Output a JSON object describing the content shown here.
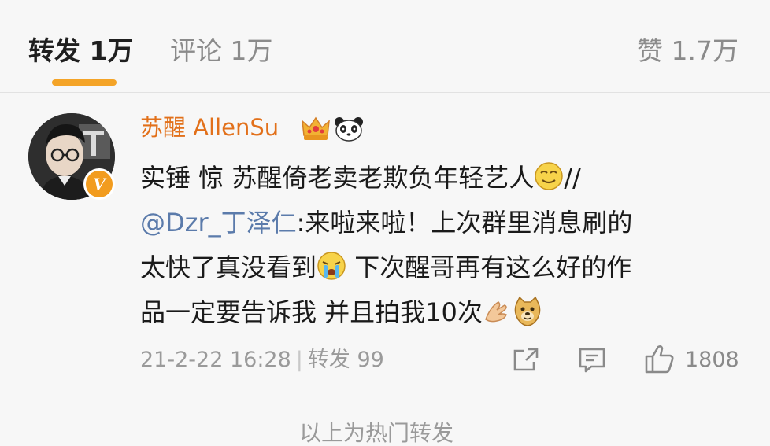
{
  "tabs": {
    "repost": "转发 1万",
    "comment": "评论 1万",
    "like": "赞 1.7万"
  },
  "post": {
    "username": "苏醒 AllenSu",
    "content_lines": [
      "实锤 惊 苏醒倚老卖老欺负年轻艺人",
      "//",
      "@Dzr_丁泽仁",
      ":来啦来啦！上次群里消息刷的",
      "太快了真没看到",
      " 下次醒哥再有这么好的作",
      "品一定要告诉我 并且拍我10次"
    ],
    "timestamp": "21-2-22 16:28",
    "separator": "|",
    "repost_info": "转发 99",
    "like_count": "1808"
  },
  "footer": {
    "text": "以上为热门转发"
  },
  "colors": {
    "accent": "#f4a428",
    "username": "#e2701a",
    "mention": "#5b7bab",
    "muted": "#9a9a9a"
  },
  "icons": {
    "badge": "verified-v-icon",
    "crown": "crown-icon",
    "panda": "panda-icon",
    "emoji_smirk": "smirk-emoji",
    "emoji_cry": "crying-emoji",
    "emoji_clap": "clap-hands-emoji",
    "emoji_doge": "doge-emoji",
    "share": "share-icon",
    "comment": "comment-icon",
    "like": "thumbs-up-icon"
  }
}
